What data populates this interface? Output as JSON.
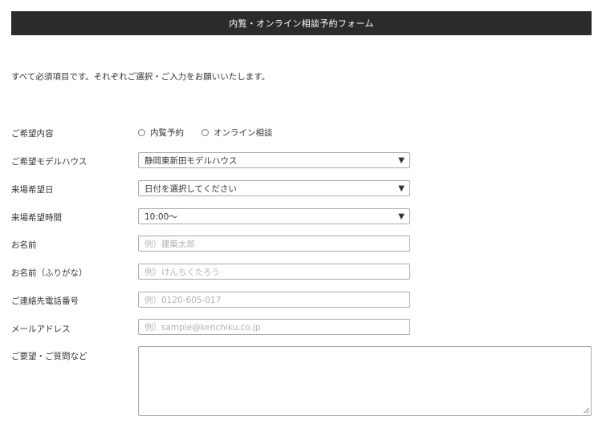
{
  "header": {
    "title": "内覧・オンライン相談予約フォーム"
  },
  "intro": {
    "text": "すべて必須項目です。それぞれご選択・ご入力をお願いいたします。"
  },
  "form": {
    "request_type": {
      "label": "ご希望内容",
      "options": [
        "内覧予約",
        "オンライン相談"
      ]
    },
    "model_house": {
      "label": "ご希望モデルハウス",
      "value": "静岡東新田モデルハウス"
    },
    "visit_date": {
      "label": "来場希望日",
      "value": "日付を選択してください"
    },
    "visit_time": {
      "label": "来場希望時間",
      "value": "10:00～"
    },
    "name": {
      "label": "お名前",
      "placeholder": "例）建築太郎"
    },
    "name_kana": {
      "label": "お名前（ふりがな）",
      "placeholder": "例）けんちくたろう"
    },
    "phone": {
      "label": "ご連絡先電話番号",
      "placeholder": "例）0120-605-017"
    },
    "email": {
      "label": "メールアドレス",
      "placeholder": "例）sample@kenchiku.co.jp"
    },
    "message": {
      "label": "ご要望・ご質問など"
    }
  },
  "icons": {
    "select_caret": "caret-down-icon",
    "radio": "radio-unchecked-icon"
  }
}
